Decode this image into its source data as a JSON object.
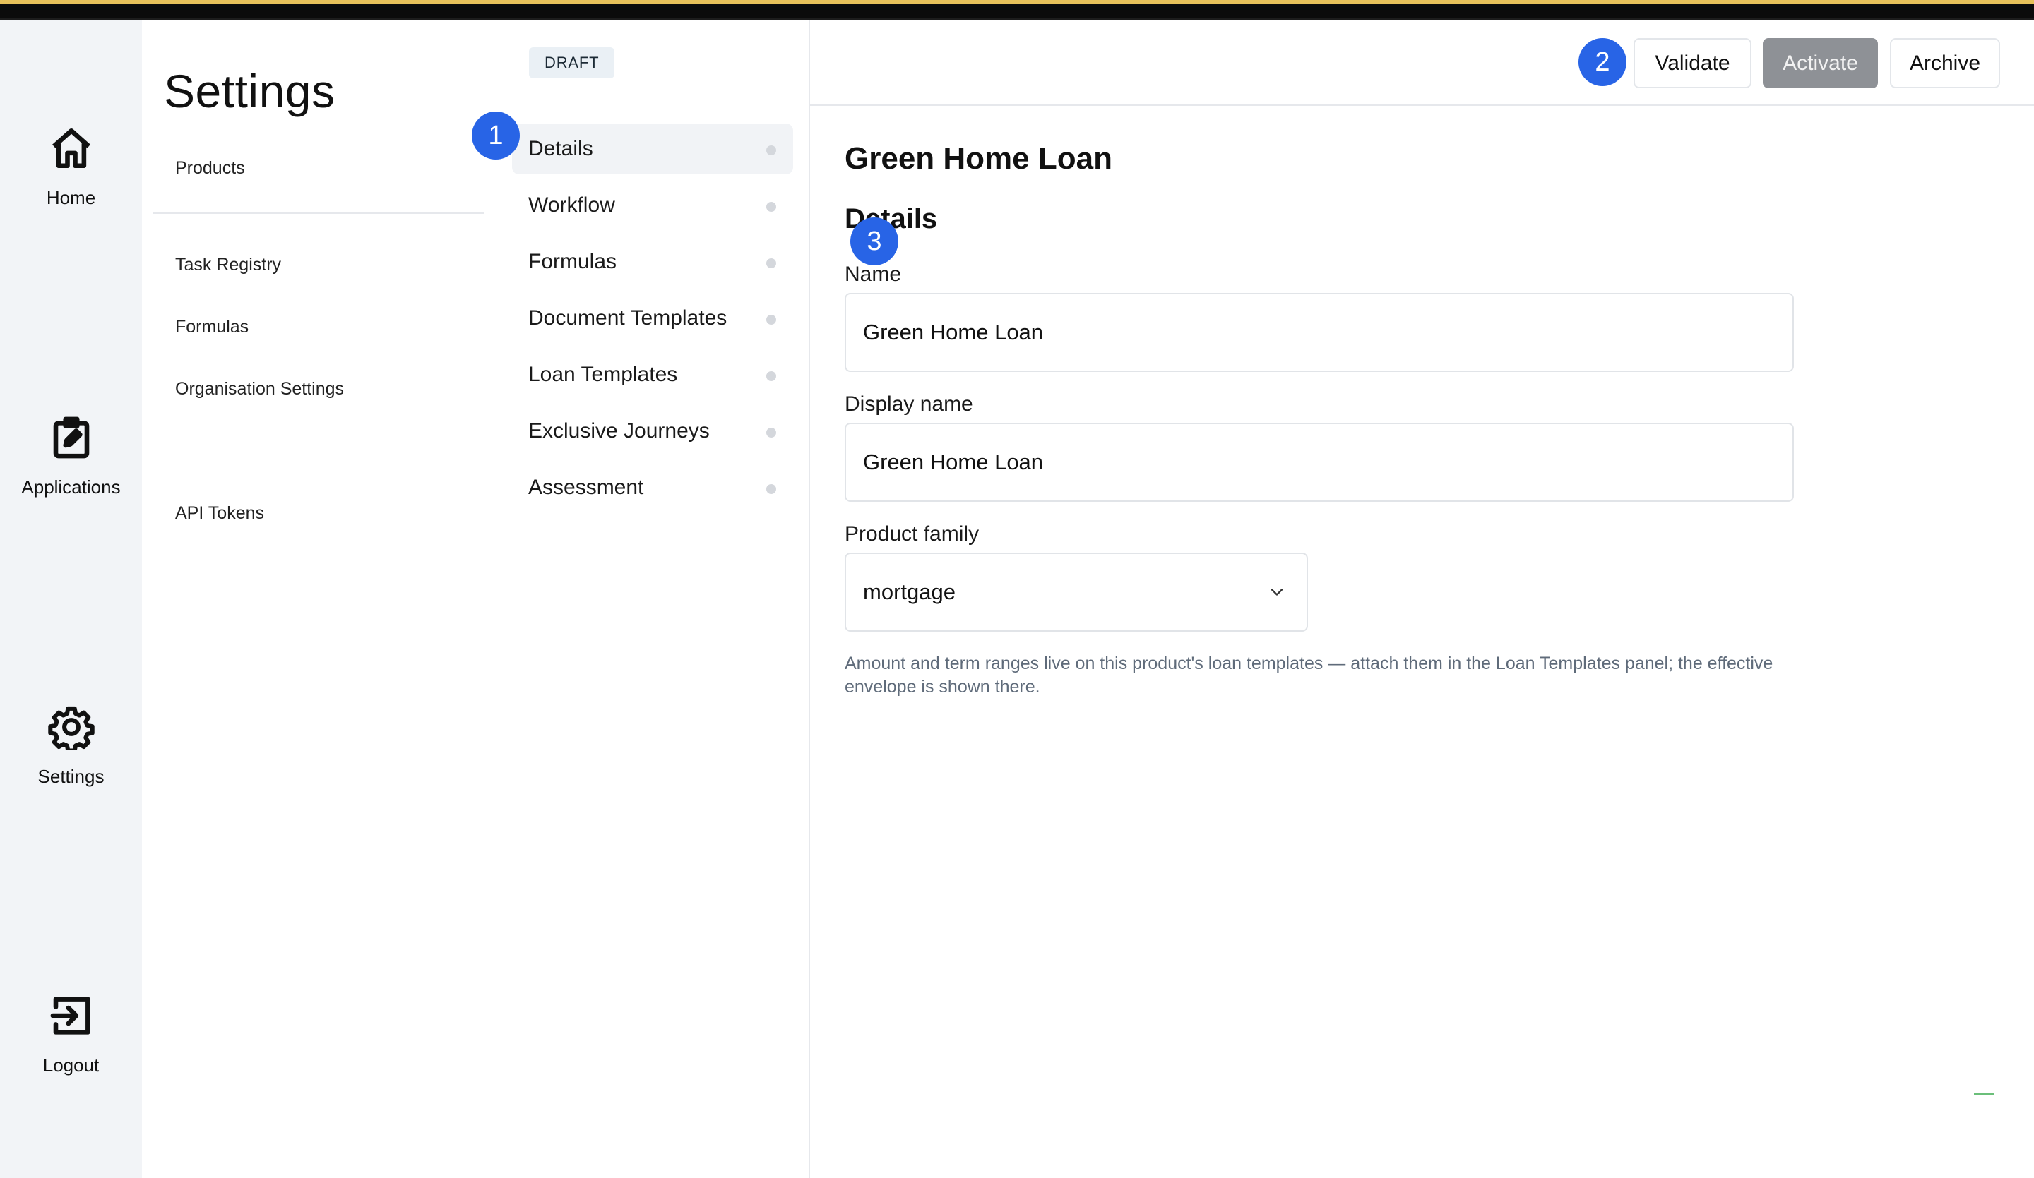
{
  "rail": {
    "items": [
      {
        "label": "Home",
        "icon": "home-icon"
      },
      {
        "label": "Applications",
        "icon": "clipboard-edit-icon"
      },
      {
        "label": "Settings",
        "icon": "gear-icon"
      },
      {
        "label": "Logout",
        "icon": "logout-icon"
      }
    ]
  },
  "settings_nav": {
    "title": "Settings",
    "links": [
      "Products",
      "Task Registry",
      "Formulas",
      "Organisation Settings",
      "API Tokens"
    ]
  },
  "section_nav": {
    "status_badge": "DRAFT",
    "items": [
      {
        "label": "Details",
        "active": true
      },
      {
        "label": "Workflow",
        "active": false
      },
      {
        "label": "Formulas",
        "active": false
      },
      {
        "label": "Document Templates",
        "active": false
      },
      {
        "label": "Loan Templates",
        "active": false
      },
      {
        "label": "Exclusive Journeys",
        "active": false
      },
      {
        "label": "Assessment",
        "active": false
      }
    ]
  },
  "header": {
    "buttons": {
      "validate": "Validate",
      "activate": "Activate",
      "archive": "Archive"
    }
  },
  "step_markers": [
    "1",
    "2",
    "3"
  ],
  "main": {
    "title": "Green Home Loan",
    "section_heading": "Details",
    "fields": {
      "name": {
        "label": "Name",
        "value": "Green Home Loan"
      },
      "display_name": {
        "label": "Display name",
        "value": "Green Home Loan"
      },
      "product_family": {
        "label": "Product family",
        "value": "mortgage"
      }
    },
    "hint": "Amount and term ranges live on this product's loan templates — attach them in the Loan Templates panel; the effective envelope is shown there."
  },
  "colors": {
    "accent": "#2864e6",
    "primary_button_disabled": "#8e9196",
    "rail_background": "#f2f4f7",
    "hint_text": "#5f6b7a"
  }
}
